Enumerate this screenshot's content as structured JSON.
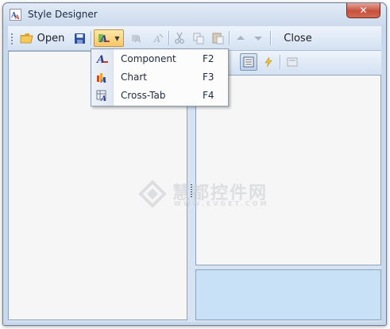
{
  "window": {
    "title": "Style Designer",
    "close_glyph": "✕"
  },
  "toolbar": {
    "open_label": "Open",
    "close_label": "Close",
    "icons": [
      "open-folder-icon",
      "save-icon",
      "add-style-icon",
      "dropdown-arrow-icon",
      "style-disabled-icon",
      "style-disabled-icon",
      "cut-icon",
      "copy-icon",
      "paste-icon",
      "move-up-icon",
      "move-down-icon"
    ]
  },
  "dropdown_menu": {
    "items": [
      {
        "label": "Component",
        "shortcut": "F2",
        "icon": "component-style-icon"
      },
      {
        "label": "Chart",
        "shortcut": "F3",
        "icon": "chart-style-icon"
      },
      {
        "label": "Cross-Tab",
        "shortcut": "F4",
        "icon": "crosstab-style-icon"
      }
    ]
  },
  "watermark": {
    "main": "慧都控件网",
    "sub": "WWW.EVGET.COM"
  },
  "colors": {
    "titlebar": "#cbdaec",
    "client": "#d5e3f3",
    "panel": "#f6f6f6",
    "bottom_panel": "#c9e1f6",
    "close_button": "#c6513c",
    "highlight": "#f8c768"
  }
}
